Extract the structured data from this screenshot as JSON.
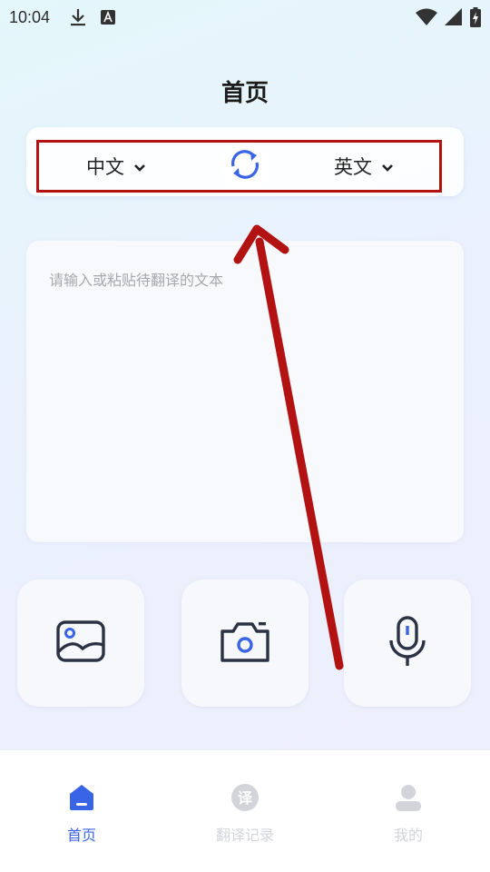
{
  "status_bar": {
    "time": "10:04",
    "icons": [
      "download-icon",
      "a-letter-icon",
      "wifi-icon",
      "signal-icon",
      "battery-charging-icon"
    ]
  },
  "page": {
    "title": "首页"
  },
  "language_bar": {
    "source_lang": "中文",
    "target_lang": "英文",
    "swap_icon": "refresh-swap-icon"
  },
  "input": {
    "placeholder": "请输入或粘贴待翻译的文本",
    "value": ""
  },
  "tools": [
    {
      "name": "image-translate",
      "icon": "image-icon"
    },
    {
      "name": "camera-translate",
      "icon": "camera-icon"
    },
    {
      "name": "voice-translate",
      "icon": "microphone-icon"
    }
  ],
  "bottom_nav": {
    "items": [
      {
        "label": "首页",
        "icon": "home-icon",
        "active": true
      },
      {
        "label": "翻译记录",
        "icon": "translate-record-icon",
        "active": false
      },
      {
        "label": "我的",
        "icon": "user-icon",
        "active": false
      }
    ]
  },
  "colors": {
    "accent": "#3a64e6",
    "annotation": "#b21212",
    "inactive": "#d2d4da"
  }
}
